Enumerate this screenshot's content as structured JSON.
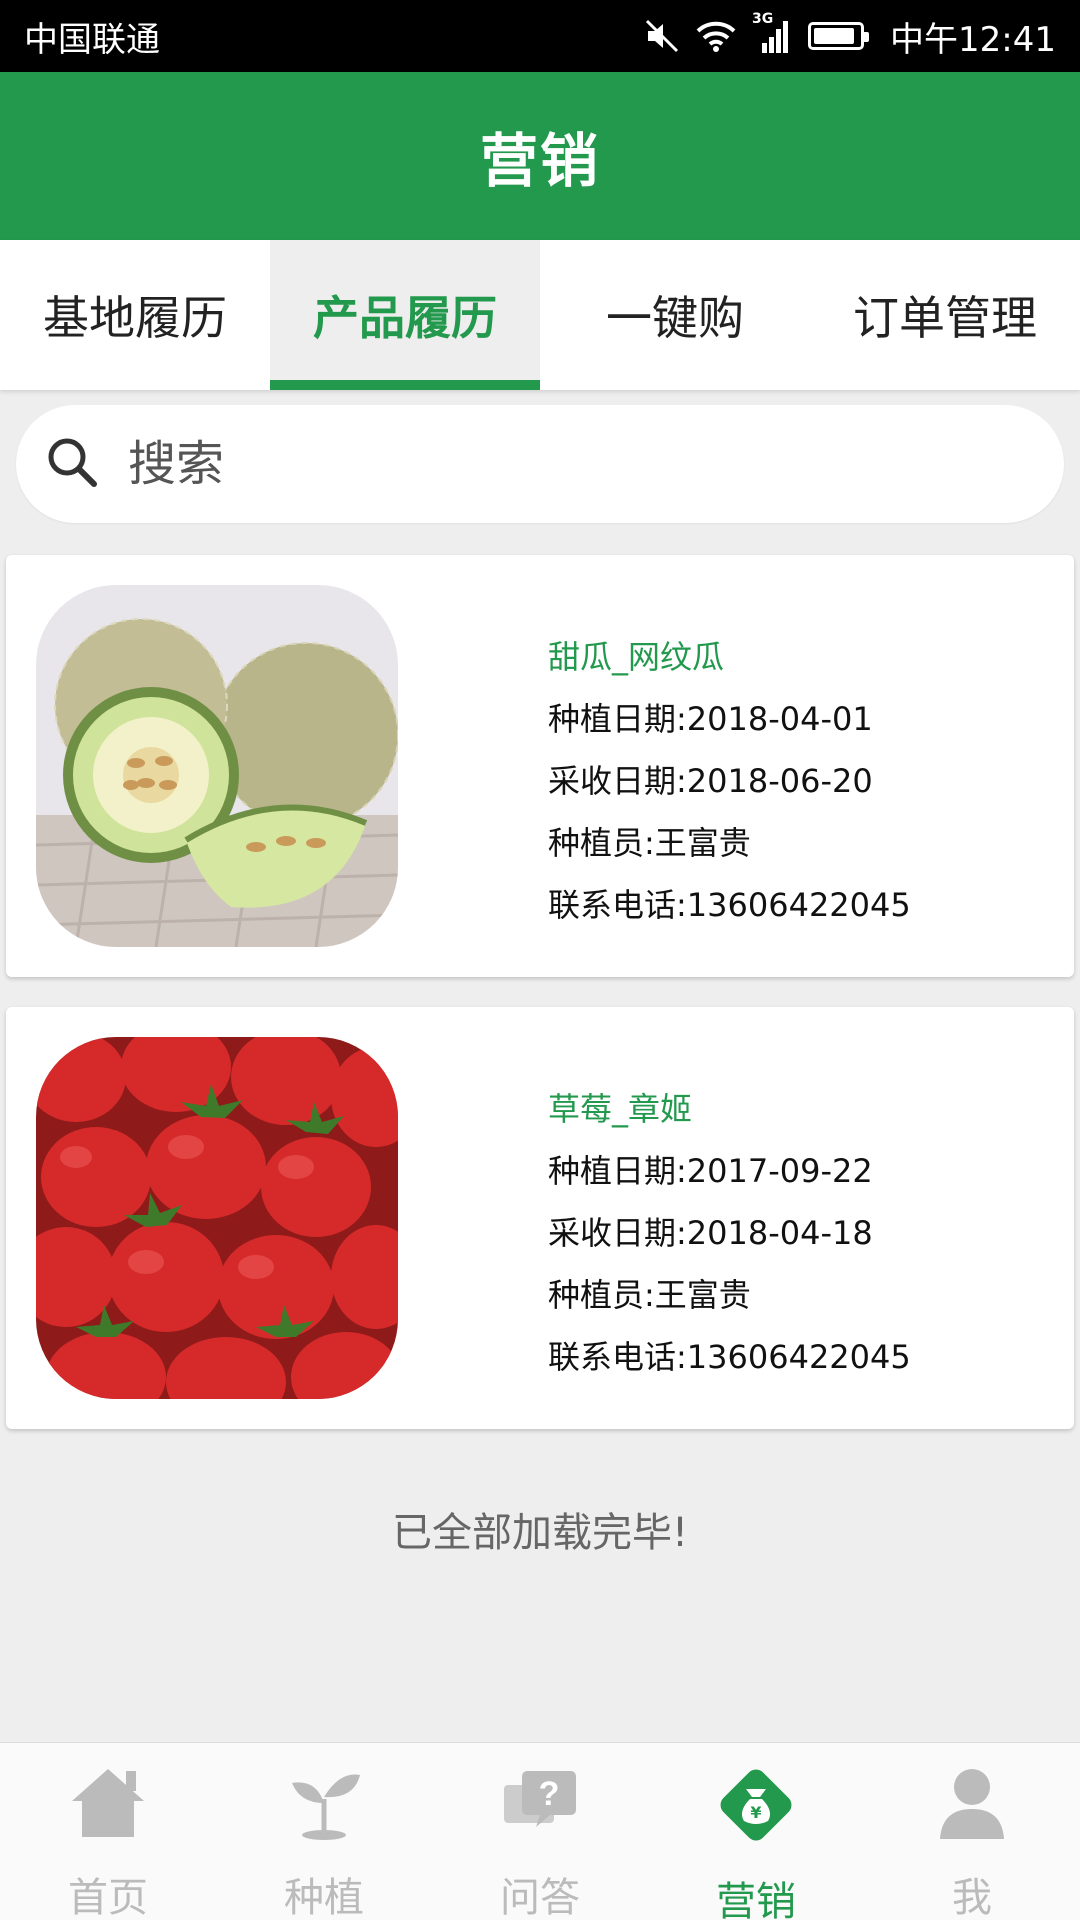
{
  "status_bar": {
    "carrier": "中国联通",
    "network": "3G",
    "time": "中午12:41"
  },
  "header": {
    "title": "营销"
  },
  "tabs": [
    {
      "label": "基地履历",
      "active": false
    },
    {
      "label": "产品履历",
      "active": true
    },
    {
      "label": "一键购",
      "active": false
    },
    {
      "label": "订单管理",
      "active": false
    }
  ],
  "search": {
    "placeholder": "搜索",
    "icon": "search-icon"
  },
  "products": [
    {
      "name": "甜瓜_网纹瓜",
      "plant_date": "种植日期:2018-04-01",
      "harvest_date": "采收日期:2018-06-20",
      "grower": "种植员:王富贵",
      "phone": "联系电话:13606422045",
      "image": "melon-image"
    },
    {
      "name": "草莓_章姬",
      "plant_date": "种植日期:2017-09-22",
      "harvest_date": "采收日期:2018-04-18",
      "grower": "种植员:王富贵",
      "phone": "联系电话:13606422045",
      "image": "strawberry-image"
    }
  ],
  "list_footer": "已全部加载完毕!",
  "bottom_nav": [
    {
      "label": "首页",
      "icon": "home-icon",
      "active": false
    },
    {
      "label": "种植",
      "icon": "sprout-icon",
      "active": false
    },
    {
      "label": "问答",
      "icon": "qa-icon",
      "active": false
    },
    {
      "label": "营销",
      "icon": "money-bag-icon",
      "active": true
    },
    {
      "label": "我",
      "icon": "user-icon",
      "active": false
    }
  ],
  "colors": {
    "primary": "#23994d",
    "background": "#eeeeee",
    "inactive": "#bbbbbb"
  }
}
